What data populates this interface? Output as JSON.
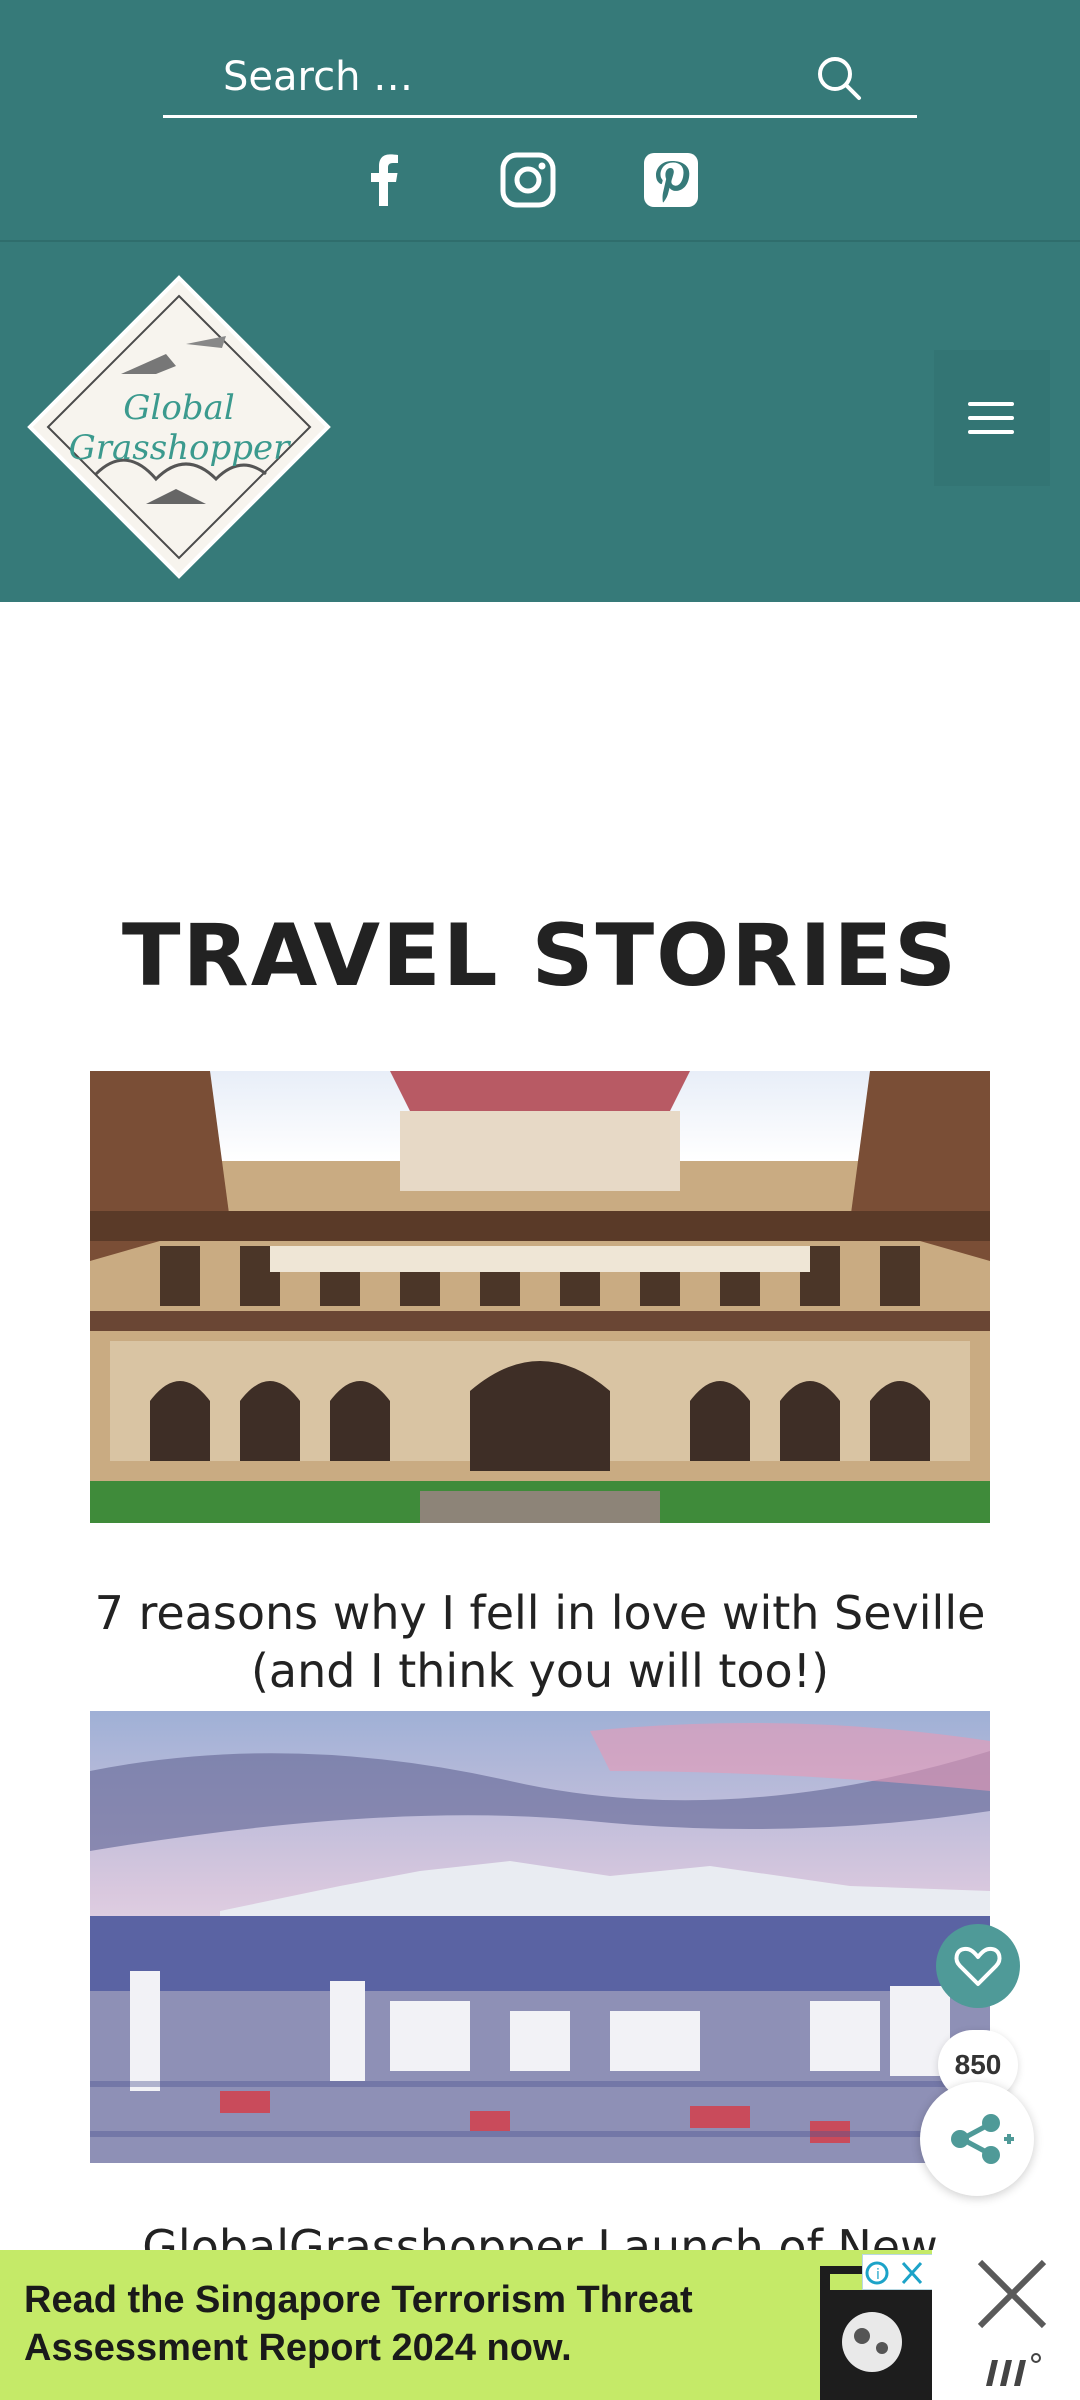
{
  "search": {
    "placeholder": "Search …"
  },
  "social": [
    "facebook-icon",
    "instagram-icon",
    "pinterest-icon"
  ],
  "header": {
    "logo_text": "Global Grasshopper"
  },
  "page": {
    "title": "TRAVEL STORIES"
  },
  "posts": [
    {
      "title": "7 reasons why I fell in love with Seville (and I think you will too!)"
    },
    {
      "title": ""
    },
    {
      "title": "GlobalGrasshopper Launch of New"
    }
  ],
  "share": {
    "count": "850"
  },
  "ad": {
    "text": "Read the Singapore Terrorism Threat Assessment Report 2024 now."
  },
  "colors": {
    "brand": "#367a79",
    "ad_bg": "#c5ea68",
    "fav": "#4f9a98"
  }
}
